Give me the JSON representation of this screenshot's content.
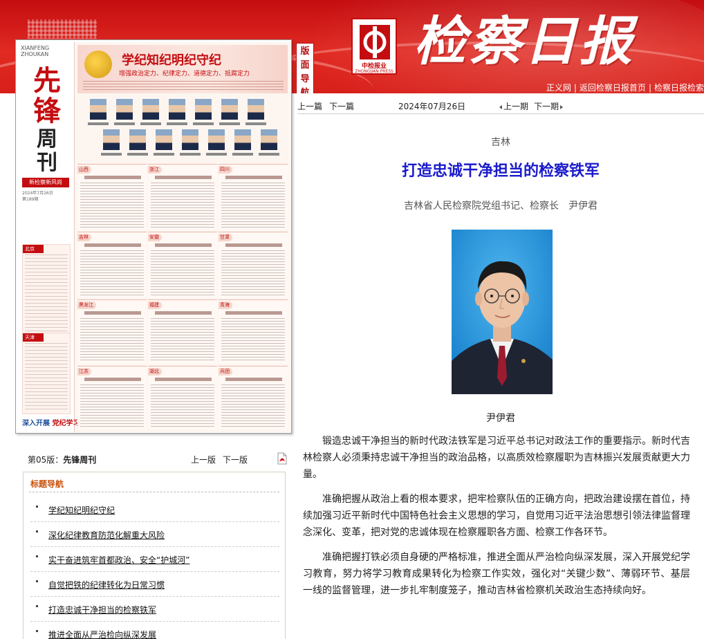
{
  "header": {
    "masthead": "检察日报",
    "logo_cn": "中检报业",
    "logo_en": "ZHONGJIAN PRESS",
    "nav_tab": [
      "版",
      "面",
      "导",
      "航"
    ],
    "links": [
      "正义网",
      "返回检察日报首页",
      "检察日报检索"
    ]
  },
  "thumbnail": {
    "brand": "XIANFENG ZHOUKAN",
    "title_top": "先锋",
    "title_bottom": "周刊",
    "tag": "新检察新风尚",
    "date": "2024年7月26日",
    "issue": "第189期",
    "banner_title": "学纪知纪明纪守纪",
    "banner_sub": "增强政治定力、纪律定力、道德定力、抵腐定力",
    "side_boxes": [
      "北京",
      "天津"
    ],
    "columns": [
      [
        "山西",
        "吉林",
        "黑龙江",
        "江苏"
      ],
      [
        "浙江",
        "安徽",
        "福建",
        "湖北"
      ],
      [
        "四川",
        "甘肃",
        "青海",
        "兵团"
      ]
    ],
    "bottom_a": "深入开展",
    "bottom_b": "党纪学习教育"
  },
  "page_row": {
    "label_prefix": "第05版：",
    "label_name": "先锋周刊",
    "prev": "上一版",
    "next": "下一版"
  },
  "nav_panel": {
    "heading": "标题导航",
    "items": [
      "学纪知纪明纪守纪",
      "深化纪律教育防范化解重大风险",
      "实干奋进筑牢首都政治、安全“护城河”",
      "自觉把铁的纪律转化为日常习惯",
      "打造忠诚干净担当的检察铁军",
      "推进全面从严治检向纵深发展"
    ]
  },
  "article_nav": {
    "prev_article": "上一篇",
    "next_article": "下一篇",
    "date": "2024年07月26日",
    "prev_issue": "上一期",
    "next_issue": "下一期"
  },
  "article": {
    "kicker": "吉林",
    "title": "打造忠诚干净担当的检察铁军",
    "byline": "吉林省人民检察院党组书记、检察长　尹伊君",
    "caption": "尹伊君",
    "paragraphs": [
      "锻造忠诚干净担当的新时代政法铁军是习近平总书记对政法工作的重要指示。新时代吉林检察人必须秉持忠诚干净担当的政治品格，以高质效检察履职为吉林振兴发展贡献更大力量。",
      "准确把握从政治上看的根本要求，把牢检察队伍的正确方向，把政治建设摆在首位，持续加强习近平新时代中国特色社会主义思想的学习，自觉用习近平法治思想引领法律监督理念深化、变革，把对党的忠诚体现在检察履职各方面、检察工作各环节。",
      "准确把握打铁必须自身硬的严格标准，推进全面从严治检向纵深发展，深入开展党纪学习教育，努力将学习教育成果转化为检察工作实效，强化对“关键少数”、薄弱环节、基层一线的监督管理，进一步扎牢制度笼子，推动吉林省检察机关政治生态持续向好。"
    ]
  },
  "colors": {
    "header_red": "#d81f1a",
    "title_blue": "#1a1acc",
    "nav_heading": "#c9510c"
  }
}
